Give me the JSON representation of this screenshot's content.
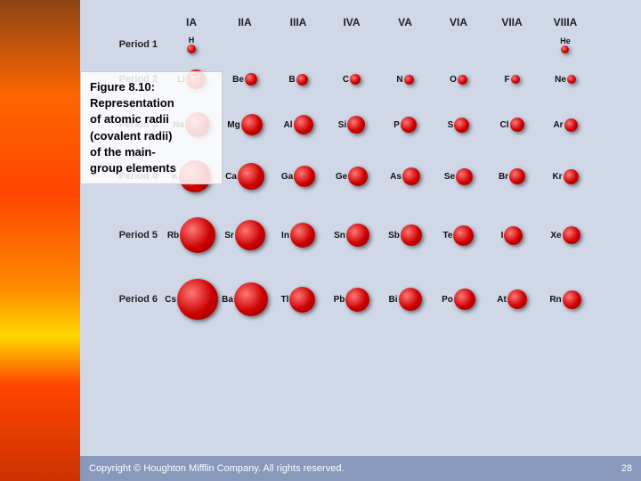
{
  "caption": {
    "figure": "Figure 8.10:",
    "line1": "Representation",
    "line2": "of atomic radii",
    "line3": "(covalent radii)",
    "line4": "of the main-",
    "line5": "group elements"
  },
  "footer": {
    "copyright": "Copyright © Houghton Mifflin Company.  All rights reserved.",
    "page": "28"
  },
  "col_headers": [
    "IA",
    "IIA",
    "IIIA",
    "IVA",
    "VA",
    "VIA",
    "VIIA",
    "VIIIA"
  ],
  "periods": [
    {
      "label": "Period 1",
      "elements": [
        {
          "symbol": "H",
          "size": 10,
          "col": 0
        },
        {
          "symbol": "He",
          "size": 9,
          "col": 7
        }
      ]
    },
    {
      "label": "Period 2",
      "elements": [
        {
          "symbol": "Li",
          "size": 22,
          "col": 0
        },
        {
          "symbol": "Be",
          "size": 14,
          "col": 1
        },
        {
          "symbol": "B",
          "size": 13,
          "col": 2
        },
        {
          "symbol": "C",
          "size": 12,
          "col": 3
        },
        {
          "symbol": "N",
          "size": 11,
          "col": 4
        },
        {
          "symbol": "O",
          "size": 11,
          "col": 5
        },
        {
          "symbol": "F",
          "size": 10,
          "col": 6
        },
        {
          "symbol": "Ne",
          "size": 10,
          "col": 7
        }
      ]
    },
    {
      "label": "Period 3",
      "elements": [
        {
          "symbol": "Na",
          "size": 28,
          "col": 0
        },
        {
          "symbol": "Mg",
          "size": 24,
          "col": 1
        },
        {
          "symbol": "Al",
          "size": 22,
          "col": 2
        },
        {
          "symbol": "Si",
          "size": 20,
          "col": 3
        },
        {
          "symbol": "P",
          "size": 18,
          "col": 4
        },
        {
          "symbol": "S",
          "size": 17,
          "col": 5
        },
        {
          "symbol": "Cl",
          "size": 16,
          "col": 6
        },
        {
          "symbol": "Ar",
          "size": 15,
          "col": 7
        }
      ]
    },
    {
      "label": "Period 4",
      "elements": [
        {
          "symbol": "K",
          "size": 36,
          "col": 0
        },
        {
          "symbol": "Ca",
          "size": 30,
          "col": 1
        },
        {
          "symbol": "Ga",
          "size": 24,
          "col": 2
        },
        {
          "symbol": "Ge",
          "size": 22,
          "col": 3
        },
        {
          "symbol": "As",
          "size": 20,
          "col": 4
        },
        {
          "symbol": "Se",
          "size": 19,
          "col": 5
        },
        {
          "symbol": "Br",
          "size": 18,
          "col": 6
        },
        {
          "symbol": "Kr",
          "size": 17,
          "col": 7
        }
      ]
    },
    {
      "label": "Period 5",
      "elements": [
        {
          "symbol": "Rb",
          "size": 40,
          "col": 0
        },
        {
          "symbol": "Sr",
          "size": 34,
          "col": 1
        },
        {
          "symbol": "In",
          "size": 28,
          "col": 2
        },
        {
          "symbol": "Sn",
          "size": 26,
          "col": 3
        },
        {
          "symbol": "Sb",
          "size": 24,
          "col": 4
        },
        {
          "symbol": "Te",
          "size": 23,
          "col": 5
        },
        {
          "symbol": "I",
          "size": 21,
          "col": 6
        },
        {
          "symbol": "Xe",
          "size": 20,
          "col": 7
        }
      ]
    },
    {
      "label": "Period 6",
      "elements": [
        {
          "symbol": "Cs",
          "size": 46,
          "col": 0
        },
        {
          "symbol": "Ba",
          "size": 38,
          "col": 1
        },
        {
          "symbol": "Tl",
          "size": 29,
          "col": 2
        },
        {
          "symbol": "Pb",
          "size": 27,
          "col": 3
        },
        {
          "symbol": "Bi",
          "size": 26,
          "col": 4
        },
        {
          "symbol": "Po",
          "size": 24,
          "col": 5
        },
        {
          "symbol": "At",
          "size": 22,
          "col": 6
        },
        {
          "symbol": "Rn",
          "size": 21,
          "col": 7
        }
      ]
    }
  ]
}
